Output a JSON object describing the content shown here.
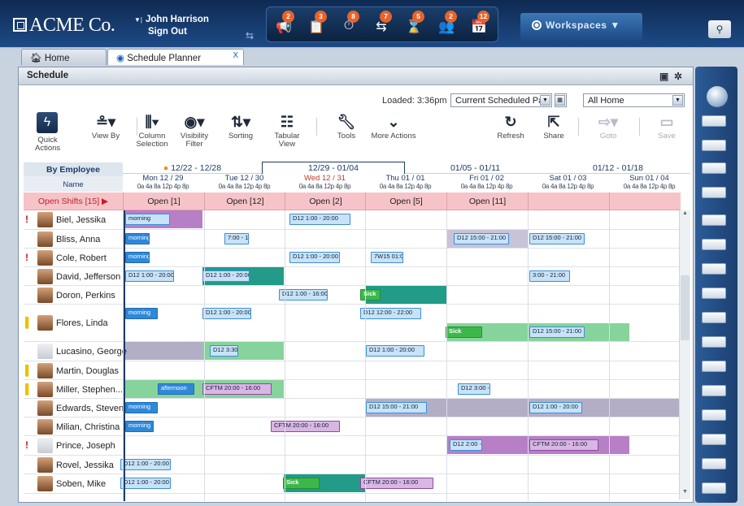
{
  "topbar": {
    "logo": "ACME Co.",
    "user_name": "John Harrison",
    "sign_out": "Sign Out",
    "workspaces": "Workspaces",
    "alerts": [
      {
        "icon": "megaphone-icon",
        "glyph": "📢",
        "count": "2"
      },
      {
        "icon": "clipboard-icon",
        "glyph": "📋",
        "count": "3"
      },
      {
        "icon": "clock-icon",
        "glyph": "⏱",
        "count": "8"
      },
      {
        "icon": "shift-swap-icon",
        "glyph": "⇆",
        "count": "7"
      },
      {
        "icon": "timeoff-icon",
        "glyph": "⌛",
        "count": "5"
      },
      {
        "icon": "users-icon",
        "glyph": "👥",
        "count": "2"
      },
      {
        "icon": "calendar-icon",
        "glyph": "📅",
        "count": "12"
      }
    ]
  },
  "tabs": {
    "home": "Home",
    "schedule": "Schedule Planner",
    "close": "X"
  },
  "panel": {
    "title": "Schedule"
  },
  "toolbar": {
    "loaded": "Loaded: 3:36pm",
    "period": "Current Scheduled Pay",
    "location": "All Home",
    "buttons": {
      "quick": "Quick\nActions",
      "viewby": "View By",
      "column": "Column\nSelection",
      "visibility": "Visibility\nFilter",
      "sorting": "Sorting",
      "tabular": "Tabular\nView",
      "tools": "Tools",
      "more": "More Actions",
      "refresh": "Refresh",
      "share": "Share",
      "goto": "Goto",
      "save": "Save"
    }
  },
  "grid": {
    "by_employee": "By Employee",
    "name_header": "Name",
    "open_shifts": "Open Shifts [15]",
    "weeks": [
      "12/22 - 12/28",
      "12/29 - 01/04",
      "01/05 - 01/11",
      "01/12 - 01/18"
    ],
    "days": [
      "Mon 12 / 29",
      "Tue 12 / 30",
      "Wed 12 / 31",
      "Thu 01 / 01",
      "Fri 01 / 02",
      "Sat 01 / 03",
      "Sun 01 / 04"
    ],
    "hours": "0a 4a 8a 12p 4p 8p",
    "open": [
      "Open [1]",
      "Open [12]",
      "Open [2]",
      "Open [5]",
      "Open [11]",
      "",
      ""
    ],
    "employees": [
      "Biel, Jessika",
      "Bliss, Anna",
      "Cole, Robert",
      "David, Jefferson",
      "Doron, Perkins",
      "Flores, Linda",
      "Lucasino, George",
      "Martin, Douglas",
      "Miller, Stephen...",
      "Edwards, Steven",
      "Milian, Christina",
      "Prince, Joseph",
      "Rovel, Jessika",
      "Soben, Mike"
    ],
    "shift_labels": {
      "morning": "morning",
      "afternoon": "afternoon",
      "sick": "Sick",
      "s1": "D12  1:00 - 20:00",
      "s2": "7:00 - 15",
      "s3": "D12  15:00 - 21:00",
      "s4": "7W15  01:00",
      "s5": "D12  1:00 - 16:00",
      "s6": "D12  12:00 - 22:00",
      "s7": "D12  3:30",
      "s8": "CFTM   20:00 - 16:00",
      "s9": "D12  3:00 -",
      "s10": "D12  2:00 -",
      "s11": "3:00 - 21:00"
    }
  }
}
